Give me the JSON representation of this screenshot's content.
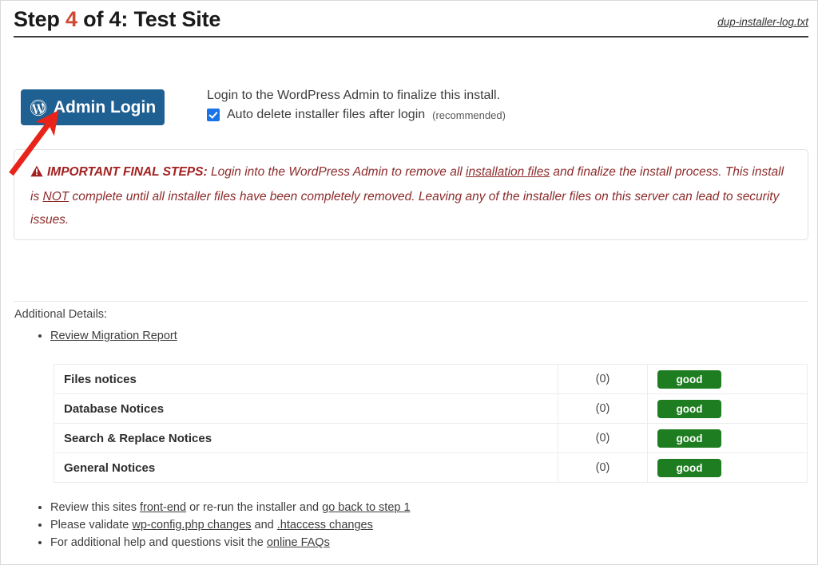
{
  "header": {
    "title_prefix": "Step ",
    "step_number": "4",
    "title_suffix": " of 4: Test Site",
    "log_link": "dup-installer-log.txt"
  },
  "login": {
    "button_label": "Admin Login",
    "button_icon": "wordpress-icon",
    "button_color": "#1f6093",
    "description": "Login to the WordPress Admin to finalize this install.",
    "auto_delete_label": "Auto delete installer files after login",
    "auto_delete_note": "(recommended)",
    "auto_delete_checked": true,
    "checkbox_color": "#1b73e8"
  },
  "notice": {
    "icon": "warning-triangle-icon",
    "heading": "IMPORTANT FINAL STEPS:",
    "part1": " Login into the WordPress Admin to remove all ",
    "link1": "installation files",
    "part2": " and finalize the install process. This install is ",
    "emphasis": "NOT",
    "part3": " complete until all installer files have been completely removed. Leaving any of the installer files on this server can lead to security issues.",
    "color": "#8d2b2b"
  },
  "additional": {
    "label": "Additional Details:",
    "links": [
      {
        "text": "Review Migration Report"
      }
    ]
  },
  "notices_table": {
    "rows": [
      {
        "name": "Files notices",
        "count": "(0)",
        "status": "good"
      },
      {
        "name": "Database Notices",
        "count": "(0)",
        "status": "good"
      },
      {
        "name": "Search & Replace Notices",
        "count": "(0)",
        "status": "good"
      },
      {
        "name": "General Notices",
        "count": "(0)",
        "status": "good"
      }
    ],
    "status_color": "#1d7d20"
  },
  "footer_list": [
    {
      "pre": "Review this sites ",
      "link1": "front-end",
      "mid": " or re-run the installer and ",
      "link2": "go back to step 1",
      "post": ""
    },
    {
      "pre": "Please validate ",
      "link1": "wp-config.php changes",
      "mid": " and ",
      "link2": ".htaccess changes",
      "post": ""
    },
    {
      "pre": "For additional help and questions visit the ",
      "link1": "online FAQs",
      "mid": "",
      "link2": "",
      "post": ""
    }
  ],
  "annotation": {
    "arrow_color": "#e8231a",
    "points_to": "admin-login-button"
  }
}
